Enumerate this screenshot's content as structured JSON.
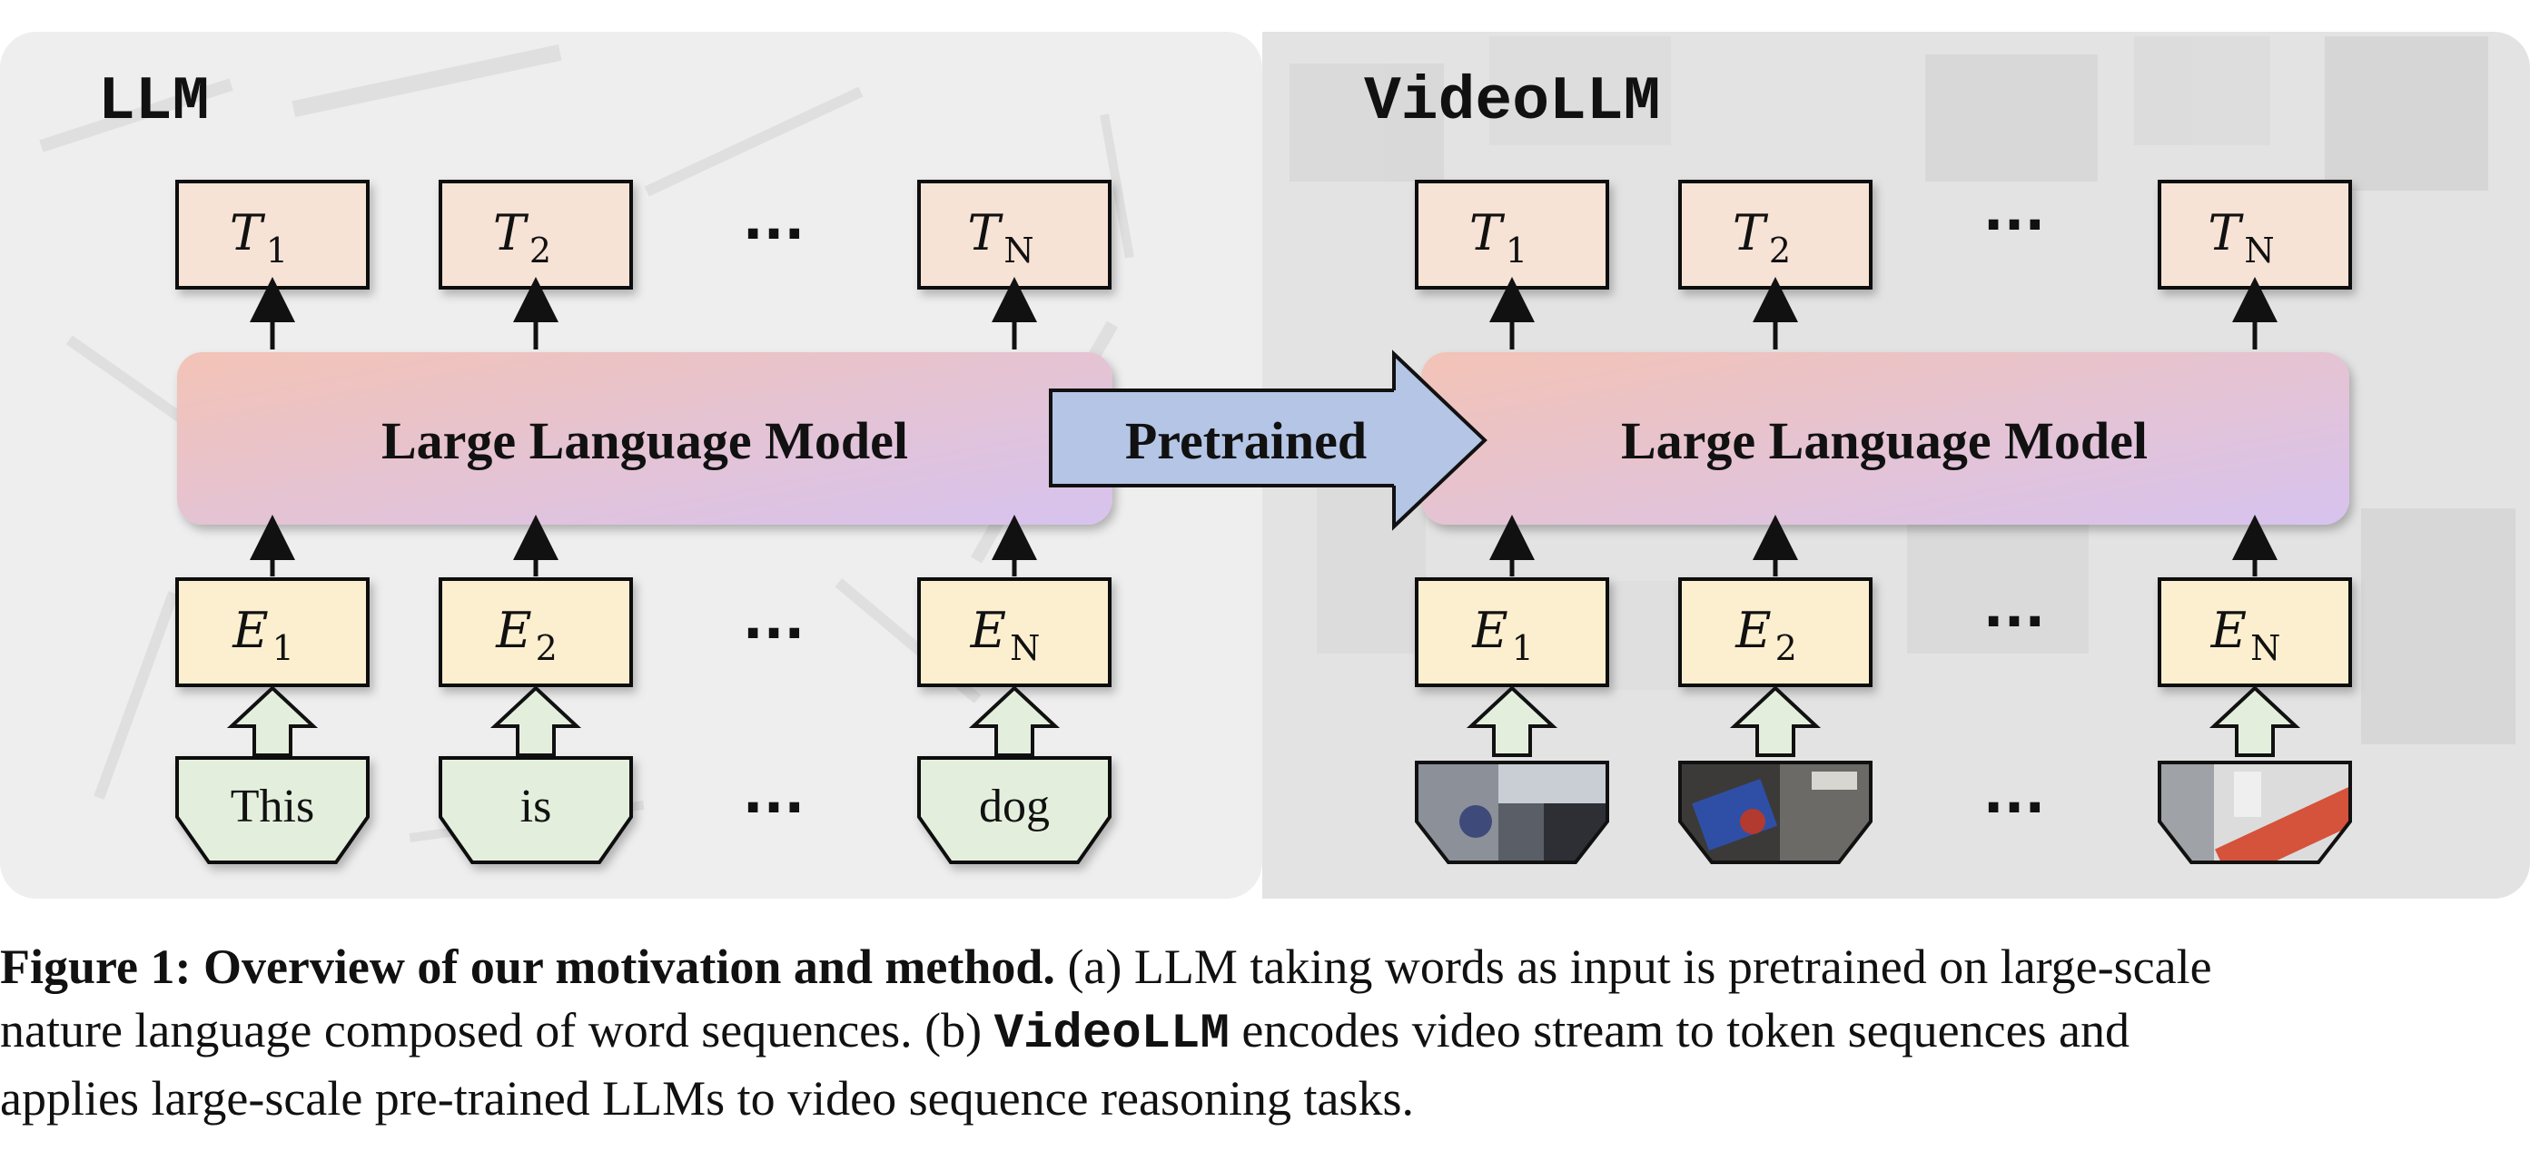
{
  "panels": {
    "left_title": "LLM",
    "right_title": "VideoLLM"
  },
  "llm_block_label": "Large Language Model",
  "arrow_label": "Pretrained",
  "ellipsis": "···",
  "left": {
    "outputs": [
      {
        "base": "T",
        "sub": "1"
      },
      {
        "base": "T",
        "sub": "2"
      },
      {
        "base": "T",
        "sub": "N"
      }
    ],
    "embeddings": [
      {
        "base": "E",
        "sub": "1"
      },
      {
        "base": "E",
        "sub": "2"
      },
      {
        "base": "E",
        "sub": "N"
      }
    ],
    "inputs": [
      "This",
      "is",
      "dog"
    ]
  },
  "right": {
    "outputs": [
      {
        "base": "T",
        "sub": "1"
      },
      {
        "base": "T",
        "sub": "2"
      },
      {
        "base": "T",
        "sub": "N"
      }
    ],
    "embeddings": [
      {
        "base": "E",
        "sub": "1"
      },
      {
        "base": "E",
        "sub": "2"
      },
      {
        "base": "E",
        "sub": "N"
      }
    ],
    "inputs": [
      "video-frame-1",
      "video-frame-2",
      "video-frame-n"
    ]
  },
  "colors": {
    "token_fill": "#f6e3d6",
    "embed_fill": "#fbefcf",
    "input_fill": "#e3efdc",
    "arrow_fill": "#b4c5e6",
    "llm_grad_start": "#f3c3b6",
    "llm_grad_end": "#d7c3ef",
    "left_bg": "#eeeeee",
    "right_bg": "#e3e3e3"
  },
  "caption": {
    "label": "Figure 1: Overview of our motivation and method.",
    "line1_rest": " (a) LLM taking words as input is pretrained on large-scale",
    "line2_a": "nature language composed of word sequences. (b) ",
    "line2_mono": "VideoLLM",
    "line2_b": " encodes video stream to token sequences and",
    "line3": "applies large-scale pre-trained LLMs to video sequence reasoning tasks."
  }
}
